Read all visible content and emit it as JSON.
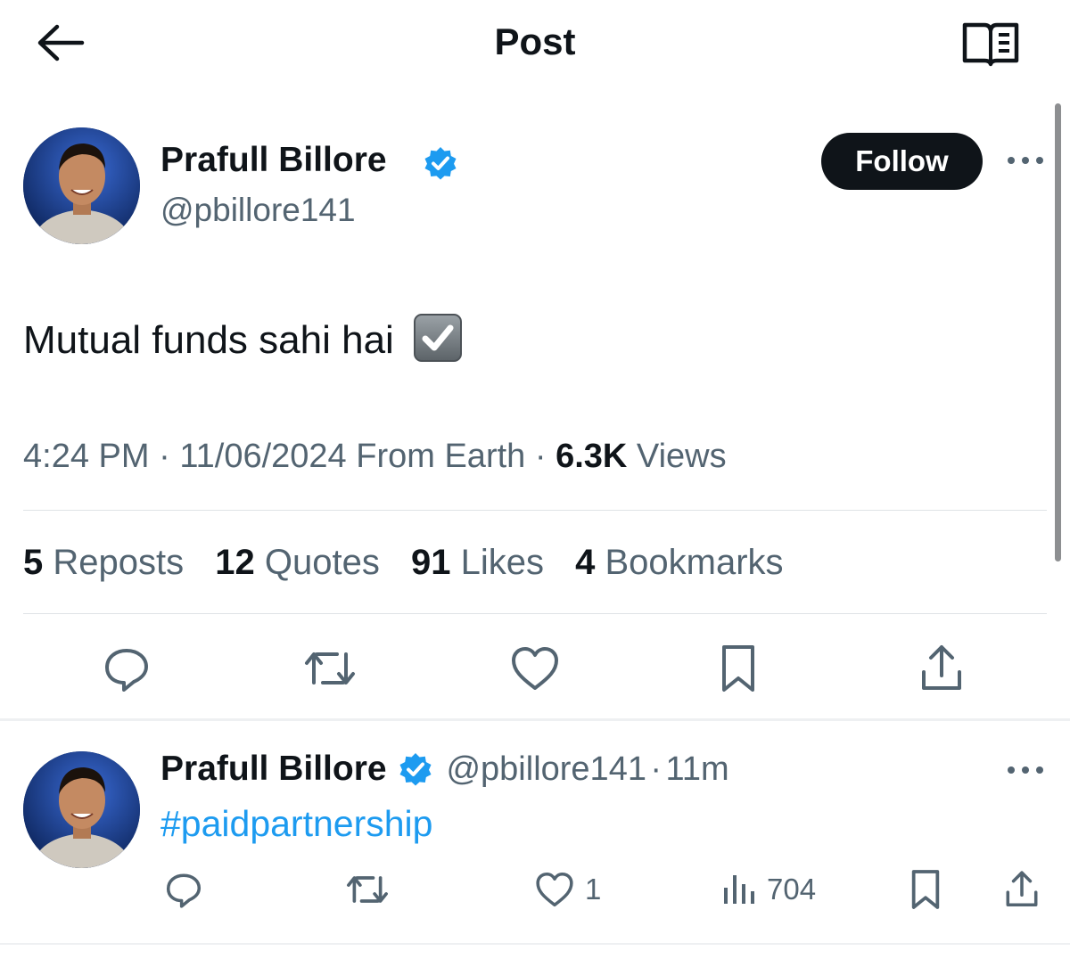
{
  "header": {
    "title": "Post",
    "back_icon": "back-arrow-icon",
    "reader_icon": "reader-mode-icon"
  },
  "post": {
    "author_name": "Prafull Billore",
    "author_handle": "@pbillore141",
    "verified": true,
    "follow_label": "Follow",
    "text": "Mutual funds sahi hai",
    "emoji": "check-mark-button-emoji",
    "time": "4:24 PM",
    "date": "11/06/2024",
    "source": "From Earth",
    "views_count": "6.3K",
    "views_label": "Views",
    "stats": [
      {
        "count": "5",
        "label": "Reposts"
      },
      {
        "count": "12",
        "label": "Quotes"
      },
      {
        "count": "91",
        "label": "Likes"
      },
      {
        "count": "4",
        "label": "Bookmarks"
      }
    ],
    "actions": [
      "reply-icon",
      "repost-icon",
      "like-icon",
      "bookmark-icon",
      "share-icon"
    ]
  },
  "reply": {
    "author_name": "Prafull Billore",
    "author_handle": "@pbillore141",
    "separator": "·",
    "time": "11m",
    "text": "#paidpartnership",
    "likes": "1",
    "views": "704"
  },
  "colors": {
    "accent": "#1d9bf0",
    "text": "#0f1419",
    "muted": "#536471",
    "follow_bg": "#0f1419"
  }
}
